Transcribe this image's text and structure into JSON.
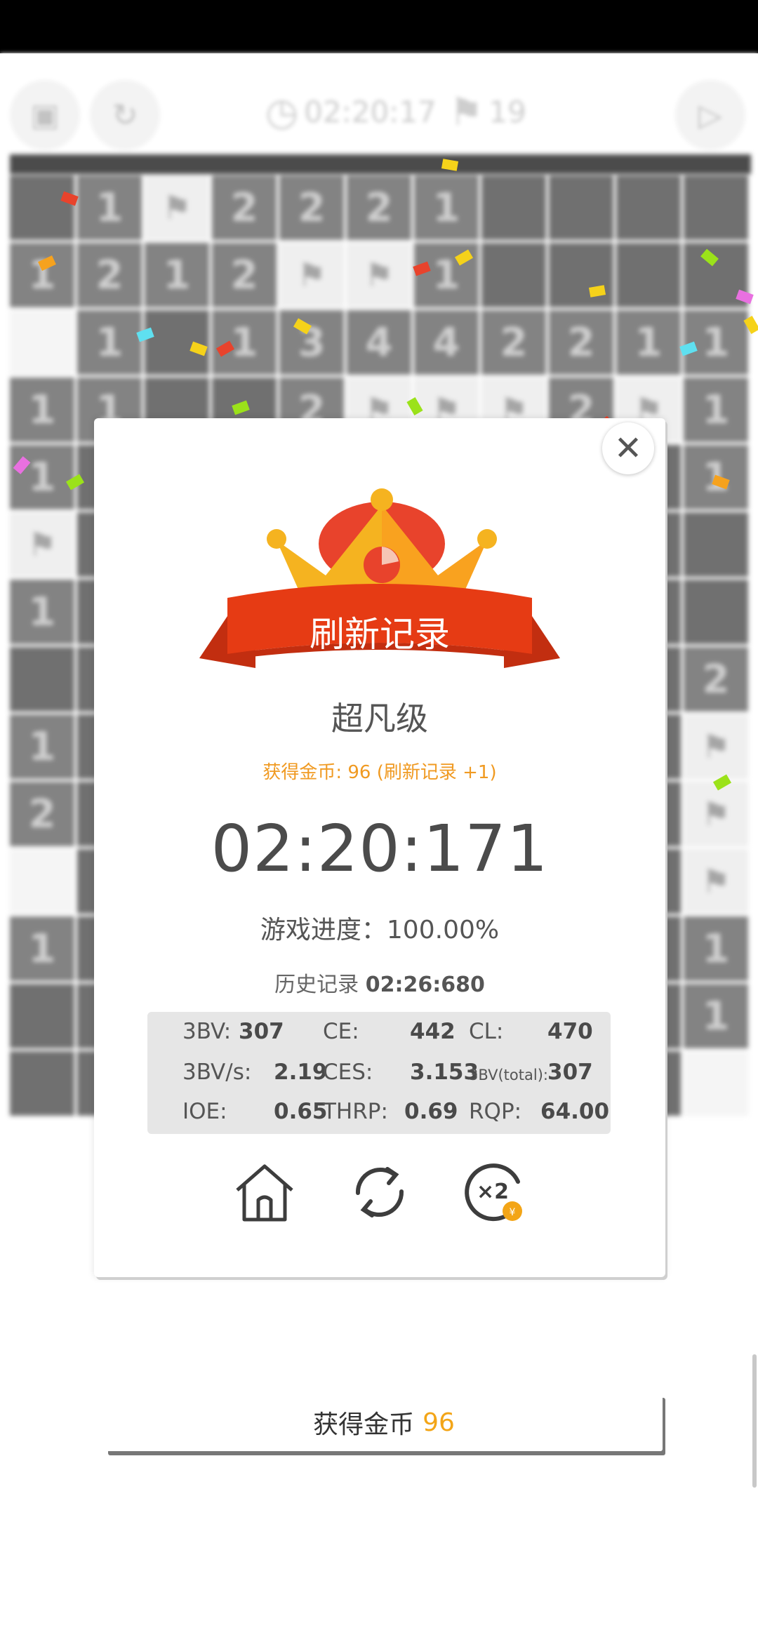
{
  "toolbar": {
    "timer": "02:20:17",
    "flags": "19",
    "icons": [
      "save-icon",
      "restart-icon",
      "clock-icon",
      "flag-icon",
      "play-icon"
    ]
  },
  "board": {
    "rows": [
      [
        "",
        "1",
        "F",
        "2",
        "2",
        "2",
        "1",
        "",
        "",
        "",
        ""
      ],
      [
        "1",
        "2",
        "1",
        "2",
        "F",
        "F",
        "1",
        "",
        "",
        "",
        ""
      ],
      [
        "W",
        "1",
        "",
        "1",
        "3",
        "4",
        "4",
        "2",
        "2",
        "1",
        "1"
      ],
      [
        "1",
        "1",
        "",
        "",
        "2",
        "F",
        "F",
        "F",
        "2",
        "F",
        "1"
      ],
      [
        "1",
        "",
        "",
        "",
        "",
        "",
        "",
        "",
        "",
        "",
        "1"
      ],
      [
        "F",
        "",
        "",
        "",
        "",
        "",
        "",
        "",
        "",
        "",
        ""
      ],
      [
        "1",
        "",
        "",
        "",
        "",
        "",
        "",
        "",
        "",
        "",
        ""
      ],
      [
        "",
        "",
        "",
        "",
        "",
        "",
        "",
        "",
        "",
        "",
        "2"
      ],
      [
        "1",
        "",
        "",
        "",
        "",
        "",
        "",
        "",
        "",
        "",
        "F"
      ],
      [
        "2",
        "",
        "",
        "",
        "",
        "",
        "",
        "",
        "",
        "",
        "F"
      ],
      [
        "W",
        "",
        "",
        "",
        "",
        "",
        "",
        "",
        "",
        "",
        "F"
      ],
      [
        "1",
        "",
        "",
        "",
        "",
        "",
        "",
        "",
        "",
        "",
        "1"
      ],
      [
        "",
        "",
        "",
        "",
        "",
        "",
        "",
        "",
        "",
        "",
        "1"
      ],
      [
        "",
        "",
        "",
        "",
        "",
        "",
        "",
        "",
        "",
        "",
        "W"
      ]
    ]
  },
  "result": {
    "banner": "刷新记录",
    "rank": "超凡级",
    "coins_line": "获得金币: 96 (刷新记录 +1)",
    "time": "02:20:171",
    "progress": "游戏进度：100.00%",
    "history_label": "历史记录",
    "history_value": "02:26:680"
  },
  "stats": {
    "bv_label": "3BV:",
    "bv": "307",
    "ce_label": "CE:",
    "ce": "442",
    "cl_label": "CL:",
    "cl": "470",
    "bvs_label": "3BV/s:",
    "bvs": "2.19",
    "ces_label": "CES:",
    "ces": "3.153",
    "bvt_label": "3BV(total):",
    "bvt": "307",
    "ioe_label": "IOE:",
    "ioe": "0.65",
    "thrp_label": "THRP:",
    "thrp": "0.69",
    "rqp_label": "RQP:",
    "rqp": "64.00"
  },
  "actions": [
    "home-icon",
    "replay-icon",
    "double-reward-icon"
  ],
  "bottom": {
    "label": "获得金币",
    "amount": "96"
  },
  "colors": {
    "orange": "#f09a22",
    "coin_yellow": "#f3a517",
    "ribbon_red": "#e63b14",
    "crown_gold": "#f9b529"
  }
}
